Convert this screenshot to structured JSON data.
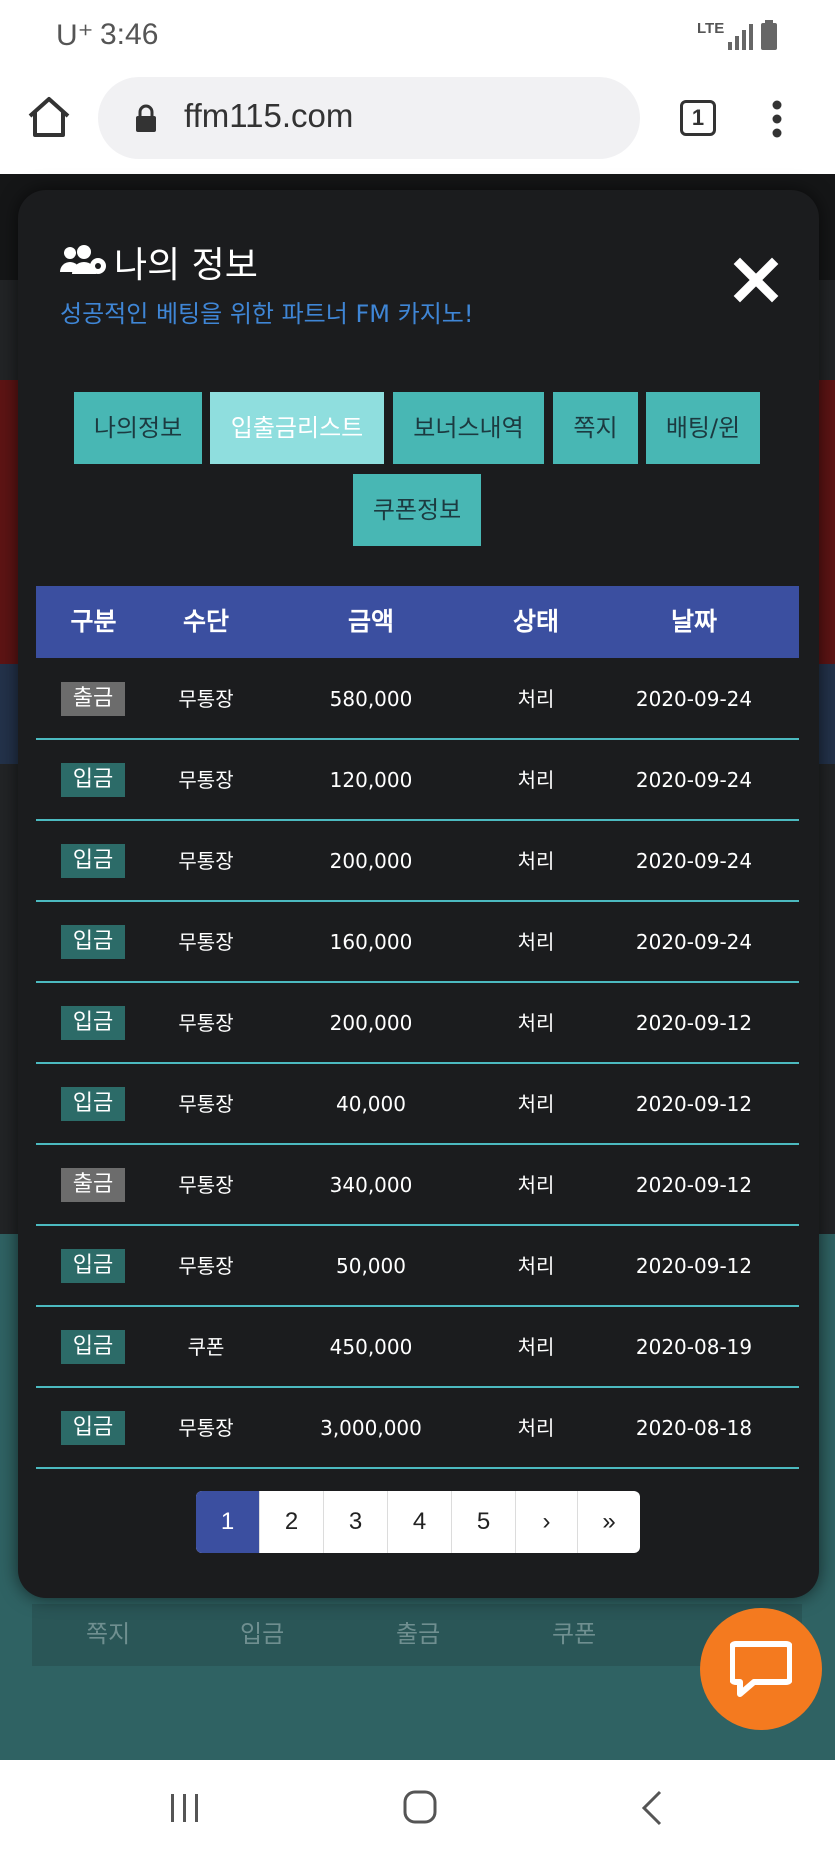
{
  "status_bar": {
    "carrier": "U⁺",
    "time": "3:46",
    "network": "LTE"
  },
  "browser": {
    "url": "ffm115.com",
    "tab_count": "1"
  },
  "background_nav": [
    "쪽지",
    "입금",
    "출금",
    "쿠폰"
  ],
  "modal": {
    "title": "나의 정보",
    "subtitle": "성공적인 베팅을 위한 파트너 FM 카지노!",
    "tabs": [
      "나의정보",
      "입출금리스트",
      "보너스내역",
      "쪽지",
      "배팅/윈",
      "쿠폰정보"
    ],
    "active_tab": "입출금리스트"
  },
  "table": {
    "headers": [
      "구분",
      "수단",
      "금액",
      "상태",
      "날짜"
    ],
    "rows": [
      {
        "type": "출금",
        "method": "무통장",
        "amount": "580,000",
        "status": "처리",
        "date": "2020-09-24"
      },
      {
        "type": "입금",
        "method": "무통장",
        "amount": "120,000",
        "status": "처리",
        "date": "2020-09-24"
      },
      {
        "type": "입금",
        "method": "무통장",
        "amount": "200,000",
        "status": "처리",
        "date": "2020-09-24"
      },
      {
        "type": "입금",
        "method": "무통장",
        "amount": "160,000",
        "status": "처리",
        "date": "2020-09-24"
      },
      {
        "type": "입금",
        "method": "무통장",
        "amount": "200,000",
        "status": "처리",
        "date": "2020-09-12"
      },
      {
        "type": "입금",
        "method": "무통장",
        "amount": "40,000",
        "status": "처리",
        "date": "2020-09-12"
      },
      {
        "type": "출금",
        "method": "무통장",
        "amount": "340,000",
        "status": "처리",
        "date": "2020-09-12"
      },
      {
        "type": "입금",
        "method": "무통장",
        "amount": "50,000",
        "status": "처리",
        "date": "2020-09-12"
      },
      {
        "type": "입금",
        "method": "쿠폰",
        "amount": "450,000",
        "status": "처리",
        "date": "2020-08-19"
      },
      {
        "type": "입금",
        "method": "무통장",
        "amount": "3,000,000",
        "status": "처리",
        "date": "2020-08-18"
      }
    ]
  },
  "pagination": {
    "pages": [
      "1",
      "2",
      "3",
      "4",
      "5"
    ],
    "next": "›",
    "last": "»",
    "current": "1"
  },
  "colors": {
    "header_blue": "#3b4fa0",
    "tab_teal": "#48b7b4",
    "tab_active": "#8fdede",
    "deposit_badge": "#2c6b68",
    "withdraw_badge": "#6c6c6c",
    "chat_orange": "#f47a1f",
    "divider": "#4cbac0"
  }
}
